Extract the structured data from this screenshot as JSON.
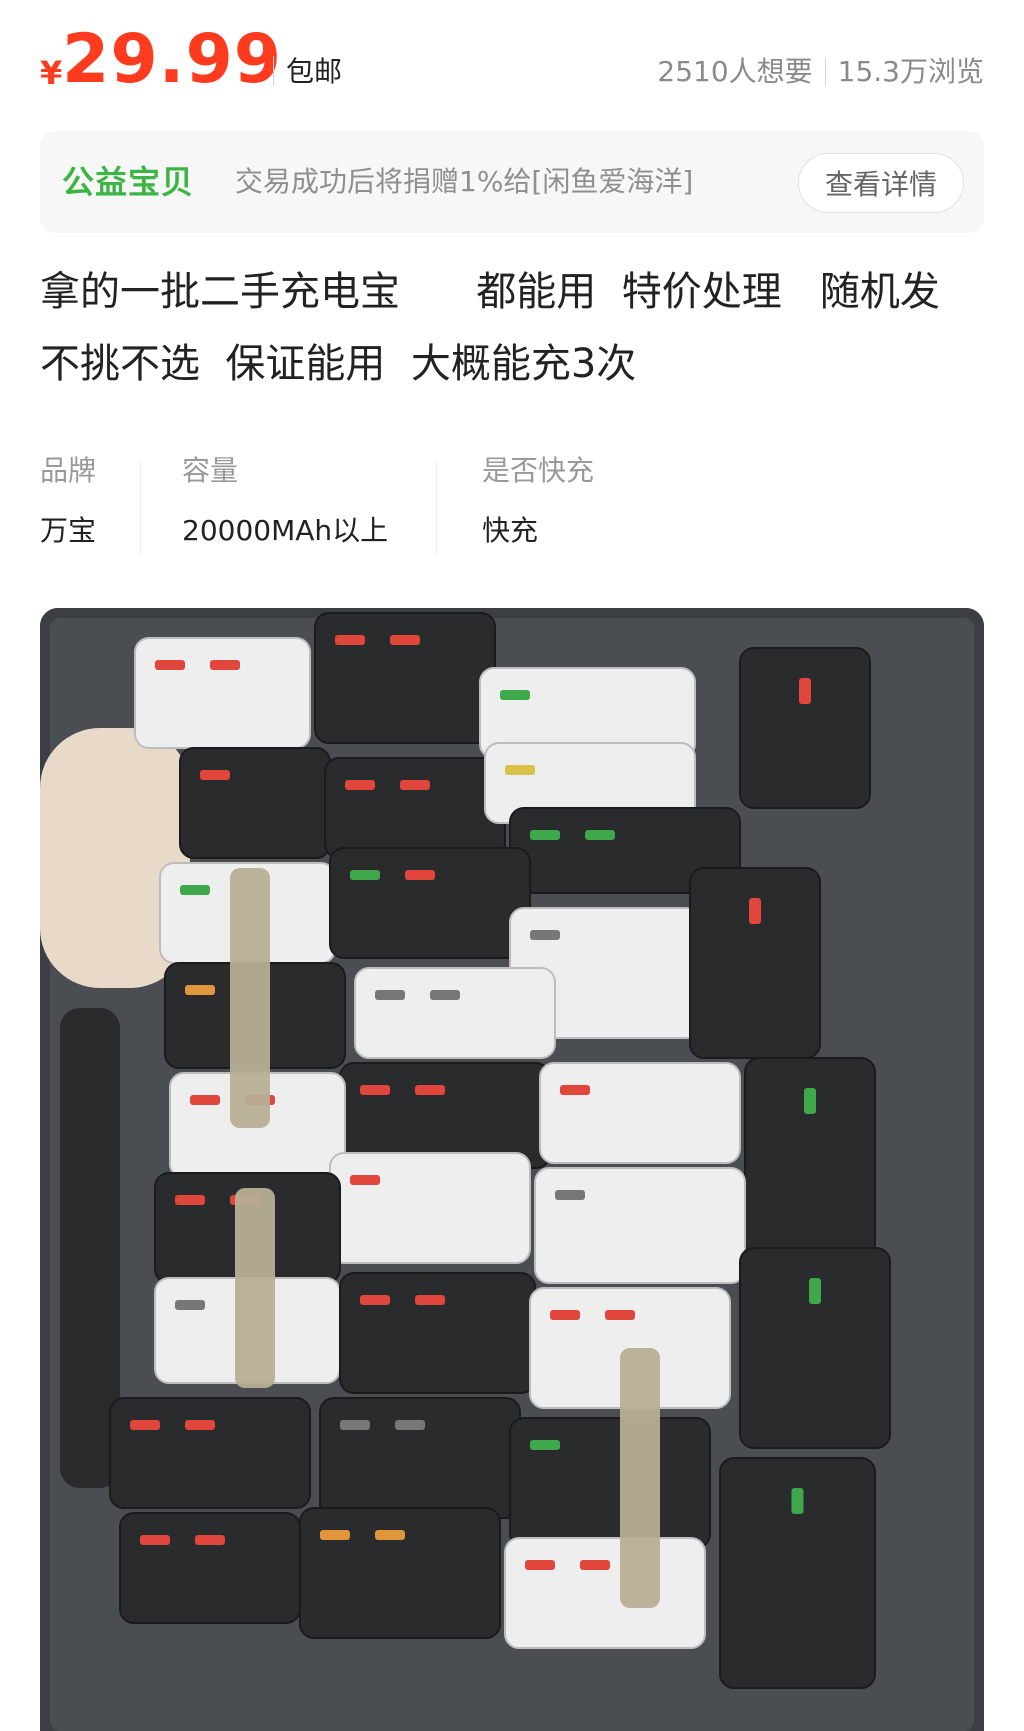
{
  "price": {
    "currency": "¥",
    "amount": "29.99",
    "shipping": "包邮"
  },
  "stats": {
    "wants": "2510人想要",
    "views": "15.3万浏览"
  },
  "charity": {
    "badge": "公益宝贝",
    "text": "交易成功后将捐赠1%给[闲鱼爱海洋]",
    "button": "查看详情"
  },
  "description": {
    "line1": "拿的一批二手充电宝      都能用  特价处理   随机发",
    "line2": "不挑不选  保证能用  大概能充3次"
  },
  "specs": [
    {
      "label": "品牌",
      "value": "万宝"
    },
    {
      "label": "容量",
      "value": "20000MAh以上"
    },
    {
      "label": "是否快充",
      "value": "快充"
    }
  ],
  "photo": {
    "subject": "power-banks-in-bin",
    "colors": {
      "bin": "#3b3e42",
      "white_unit": "#eeeeee",
      "black_unit": "#2a2b2d",
      "red_port": "#e0463b",
      "green_port": "#3ea84a"
    }
  }
}
